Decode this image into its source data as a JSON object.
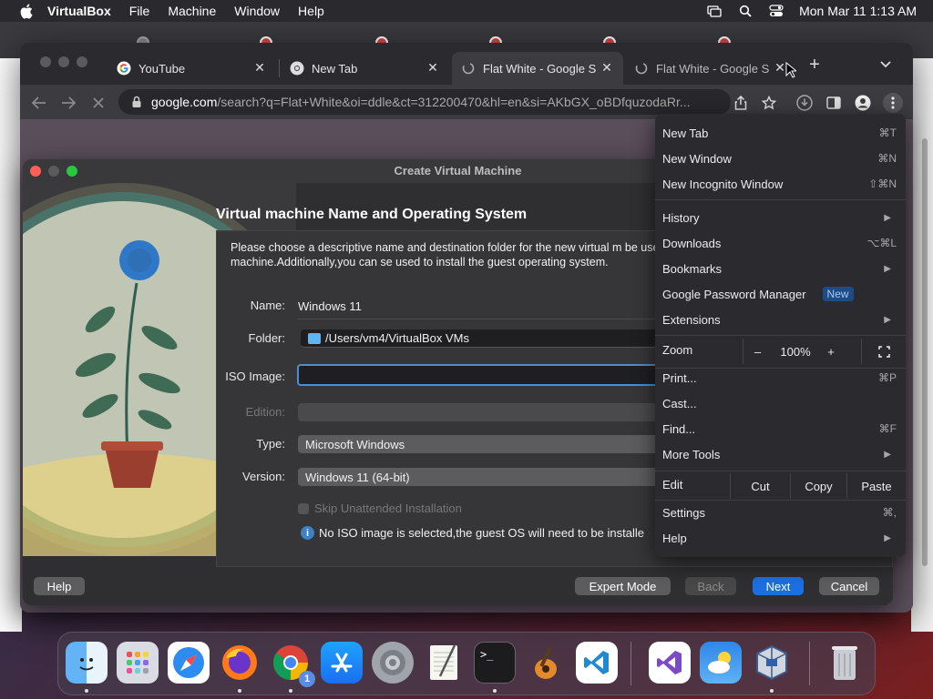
{
  "menubar": {
    "app": "VirtualBox",
    "items": [
      "File",
      "Machine",
      "Window",
      "Help"
    ],
    "clock": "Mon Mar 11  1:13 AM"
  },
  "chrome": {
    "tabs": [
      {
        "label": "YouTube",
        "favicon": "google-icon"
      },
      {
        "label": "New Tab",
        "favicon": "chrome-icon"
      },
      {
        "label": "Flat White - Google S",
        "favicon": "loading-icon"
      },
      {
        "label": "Flat White - Google S",
        "favicon": "loading-icon"
      }
    ],
    "url_host": "google.com",
    "url_rest": "/search?q=Flat+White&oi=ddle&ct=312200470&hl=en&si=AKbGX_oBDfquzodaRr..."
  },
  "vbox": {
    "window_title": "Create Virtual Machine",
    "heading": "Virtual machine Name and Operating System",
    "description": "Please choose a descriptive name and destination folder for the new virtual m be used throughout VirtualBox to identify this machine.Additionally,you can se used to install the guest operating system.",
    "labels": {
      "name": "Name:",
      "folder": "Folder:",
      "iso": "ISO Image:",
      "edition": "Edition:",
      "type": "Type:",
      "version": "Version:"
    },
    "values": {
      "name": "Windows 11",
      "folder": "/Users/vm4/VirtualBox VMs",
      "iso": "",
      "edition": "",
      "type": "Microsoft Windows",
      "version": "Windows 11 (64-bit)"
    },
    "skip_unattended": "Skip Unattended Installation",
    "info": "No ISO image is selected,the guest OS will need to be installe",
    "buttons": {
      "help": "Help",
      "expert": "Expert Mode",
      "back": "Back",
      "next": "Next",
      "cancel": "Cancel"
    }
  },
  "chrome_menu": {
    "items": [
      {
        "label": "New Tab",
        "shortcut": "⌘T"
      },
      {
        "label": "New Window",
        "shortcut": "⌘N"
      },
      {
        "label": "New Incognito Window",
        "shortcut": "⇧⌘N"
      },
      {
        "label": "History",
        "shortcut": ""
      },
      {
        "label": "Downloads",
        "shortcut": "⌥⌘L"
      },
      {
        "label": "Bookmarks",
        "shortcut": ""
      },
      {
        "label": "Google Password Manager",
        "shortcut": ""
      },
      {
        "label": "Extensions",
        "shortcut": ""
      },
      {
        "label": "Print...",
        "shortcut": "⌘P"
      },
      {
        "label": "Cast...",
        "shortcut": ""
      },
      {
        "label": "Find...",
        "shortcut": "⌘F"
      },
      {
        "label": "More Tools",
        "shortcut": ""
      },
      {
        "label": "Settings",
        "shortcut": "⌘,"
      },
      {
        "label": "Help",
        "shortcut": ""
      }
    ],
    "new_badge": "New",
    "zoom": {
      "label": "Zoom",
      "minus": "–",
      "value": "100%",
      "plus": "+"
    },
    "edit": {
      "label": "Edit",
      "cut": "Cut",
      "copy": "Copy",
      "paste": "Paste"
    }
  },
  "dock": {
    "apps": [
      "finder-icon",
      "launchpad-icon",
      "safari-icon",
      "firefox-icon",
      "chrome-icon",
      "app-store-icon",
      "system-settings-icon",
      "textedit-icon",
      "terminal-icon",
      "garageband-icon",
      "vscode-icon",
      "visual-studio-icon",
      "weather-icon",
      "virtualbox-icon",
      "trash-icon"
    ],
    "chrome_badge": "1"
  },
  "colors": {
    "accent": "#1b6fe0",
    "focus_ring": "#4a8fd4",
    "menu_bg": "#2b2a2e",
    "dialog_bg": "#2f2f31"
  }
}
